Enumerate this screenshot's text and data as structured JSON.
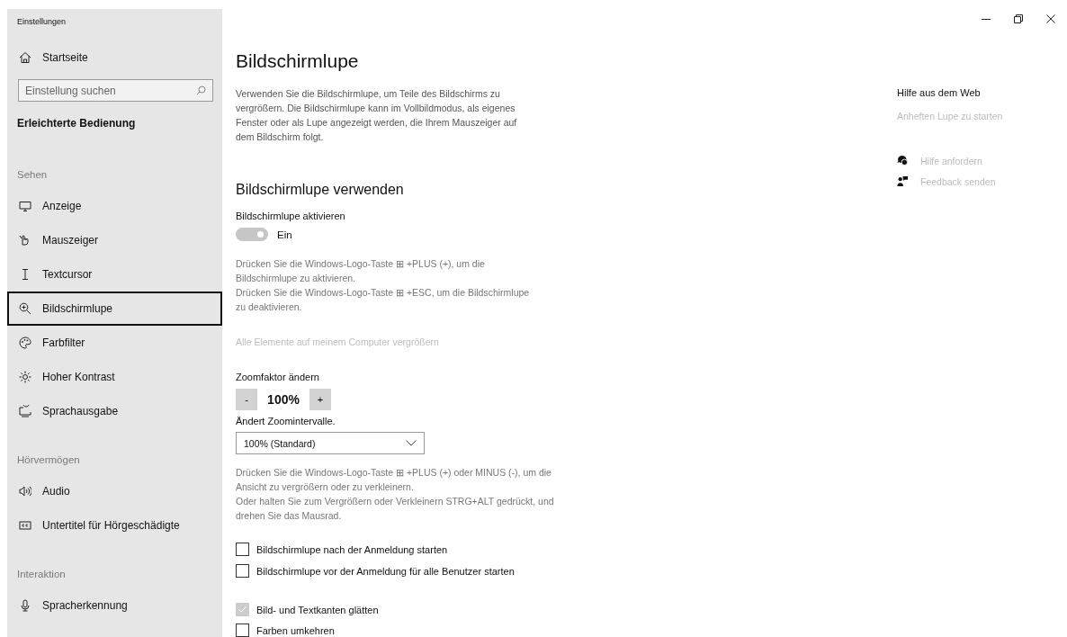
{
  "window": {
    "title": "Einstellungen",
    "controls": [
      {
        "kind": "minimize"
      },
      {
        "kind": "restore"
      },
      {
        "kind": "close"
      }
    ]
  },
  "sidebar": {
    "home": "Startseite",
    "search": {
      "placeholder": "Einstellung suchen"
    },
    "category": "Erleichterte Bedienung",
    "groups": [
      {
        "title": "Sehen",
        "items": [
          {
            "label": "Anzeige",
            "kind": "display",
            "selected": false
          },
          {
            "label": "Mauszeiger",
            "kind": "pointer",
            "selected": false
          },
          {
            "label": "Textcursor",
            "kind": "cursor",
            "selected": false
          },
          {
            "label": "Bildschirmlupe",
            "kind": "magnifier",
            "selected": true
          },
          {
            "label": "Farbfilter",
            "kind": "palette",
            "selected": false
          },
          {
            "label": "Hoher Kontrast",
            "kind": "contrast",
            "selected": false
          },
          {
            "label": "Sprachausgabe",
            "kind": "narrator",
            "selected": false
          }
        ]
      },
      {
        "title": "Hörvermögen",
        "items": [
          {
            "label": "Audio",
            "kind": "audio",
            "selected": false
          },
          {
            "label": "Untertitel für Hörgeschädigte",
            "kind": "captions",
            "selected": false
          }
        ]
      },
      {
        "title": "Interaktion",
        "items": [
          {
            "label": "Spracherkennung",
            "kind": "speech",
            "selected": false
          }
        ]
      }
    ]
  },
  "main": {
    "title": "Bildschirmlupe",
    "description": "Verwenden Sie die Bildschirmlupe, um Teile des Bildschirms zu vergrößern. Die Bildschirmlupe kann im Vollbildmodus, als eigenes Fenster oder als Lupe angezeigt werden, die Ihrem Mauszeiger auf dem Bildschirm folgt.",
    "section": "Bildschirmlupe verwenden",
    "toggle": {
      "label": "Bildschirmlupe aktivieren",
      "on": true,
      "disabled": true,
      "state": "Ein"
    },
    "toggle_hint": [
      "Drücken Sie die Windows-Logo-Taste ⊞ +PLUS (+), um die Bildschirmlupe zu aktivieren.",
      "Drücken Sie die Windows-Logo-Taste ⊞ +ESC, um die Bildschirmlupe zu deaktivieren."
    ],
    "disabled_link": "Alle Elemente auf meinem Computer vergrößern",
    "zoom": {
      "label": "Zoomfaktor ändern",
      "minus": "-",
      "value": "100%",
      "plus": "+"
    },
    "interval": {
      "label": "Ändert Zoomintervalle.",
      "value": "100% (Standard)"
    },
    "zoom_hint": [
      "Drücken Sie die Windows-Logo-Taste ⊞ +PLUS (+) oder MINUS (-), um die Ansicht zu vergrößern oder zu verkleinern.",
      "Oder halten Sie zum Vergrößern oder Verkleinern STRG+ALT gedrückt, und drehen Sie das Mausrad."
    ],
    "options": [
      {
        "label": "Bildschirmlupe nach der Anmeldung starten",
        "checked": false,
        "disabled": false
      },
      {
        "label": "Bildschirmlupe vor der Anmeldung für alle Benutzer starten",
        "checked": false,
        "disabled": false
      }
    ],
    "options2": [
      {
        "label": "Bild- und Textkanten glätten",
        "checked": true,
        "disabled": true
      },
      {
        "label": "Farben umkehren",
        "checked": false,
        "disabled": false
      }
    ]
  },
  "help": {
    "title": "Hilfe aus dem Web",
    "link": "Anheften Lupe zu starten",
    "actions": [
      {
        "label": "Hilfe anfordern",
        "kind": "help"
      },
      {
        "label": "Feedback senden",
        "kind": "feedback"
      }
    ]
  }
}
